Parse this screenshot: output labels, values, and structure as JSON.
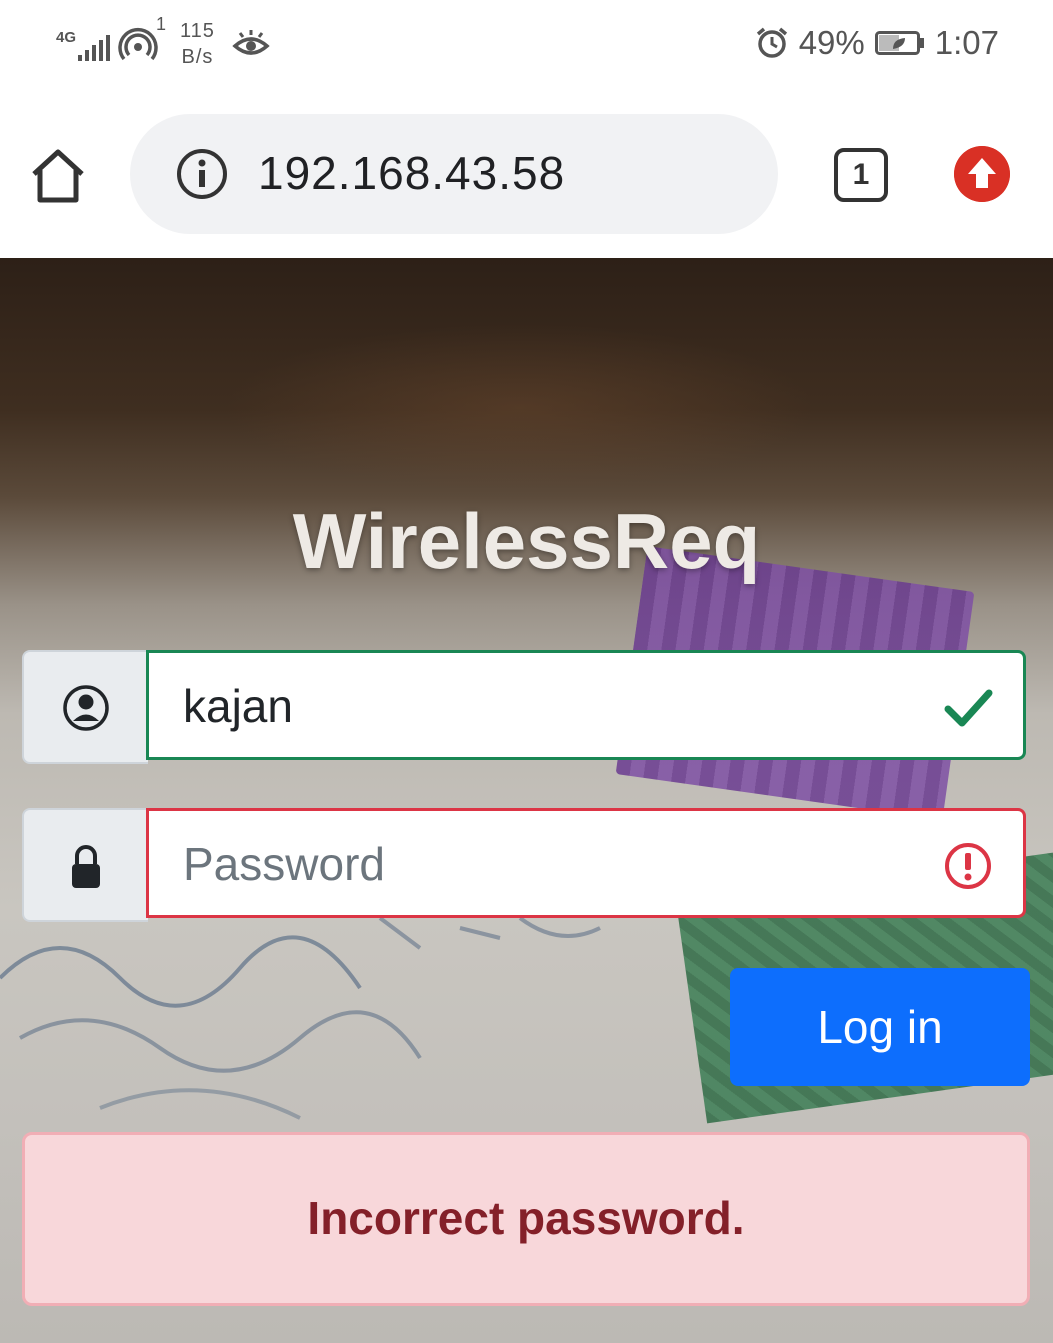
{
  "status_bar": {
    "network_type": "4G",
    "hotspot_sup": "1",
    "speed_value": "115",
    "speed_unit": "B/s",
    "battery_percent": "49%",
    "time": "1:07"
  },
  "browser": {
    "url": "192.168.43.58",
    "tab_count": "1"
  },
  "login": {
    "title": "WirelessReq",
    "username_value": "kajan",
    "password_placeholder": "Password",
    "login_label": "Log in",
    "error_message": "Incorrect password."
  },
  "colors": {
    "primary": "#0d6efd",
    "valid": "#198754",
    "invalid": "#dc3545",
    "alert_bg": "#f8d7da",
    "alert_text": "#842029",
    "update_red": "#d93025"
  },
  "icons": {
    "user": "person-circle-icon",
    "lock": "lock-icon",
    "valid": "checkmark-icon",
    "invalid": "exclamation-circle-icon"
  }
}
